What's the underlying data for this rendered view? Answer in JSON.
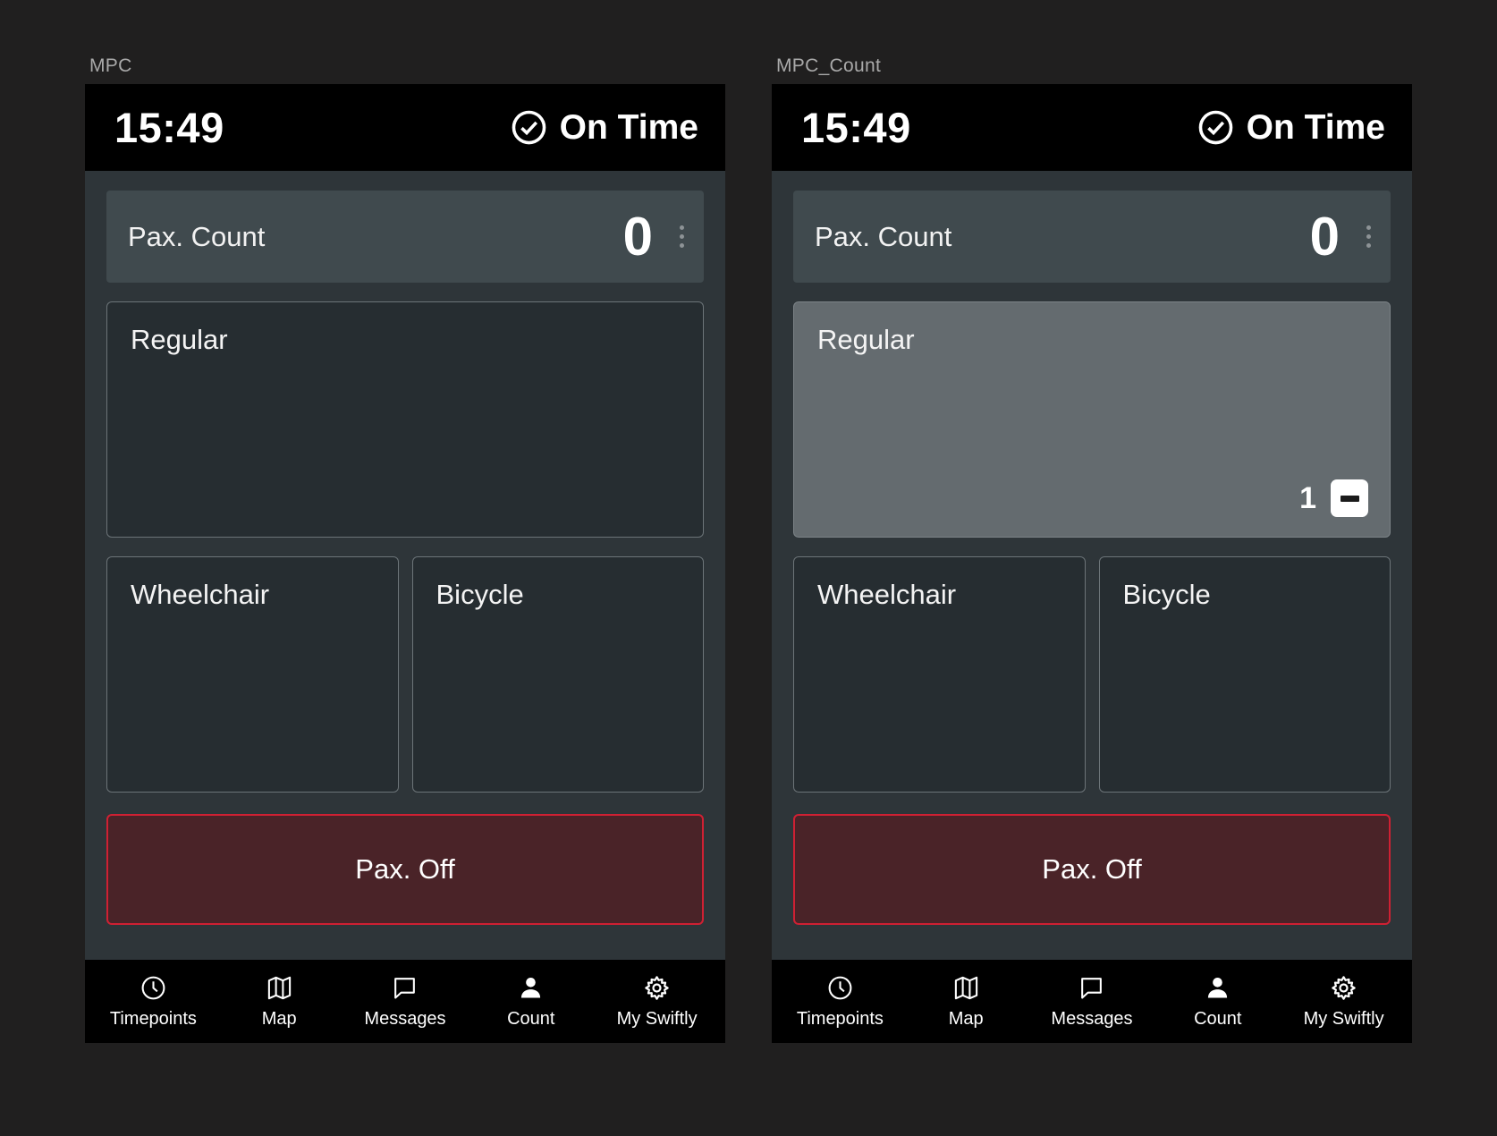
{
  "page": {
    "background_color": "#201f1f"
  },
  "panels": [
    {
      "caption": "MPC",
      "statusbar": {
        "time": "15:49",
        "status_label": "On Time",
        "status_icon": "check-circle-icon"
      },
      "pax_count": {
        "label": "Pax. Count",
        "value": "0",
        "menu_icon": "kebab-menu-icon"
      },
      "categories": [
        {
          "label": "Regular",
          "active": false,
          "counter": null
        },
        {
          "label": "Wheelchair",
          "active": false,
          "counter": null
        },
        {
          "label": "Bicycle",
          "active": false,
          "counter": null
        }
      ],
      "pax_off": {
        "label": "Pax. Off",
        "border_color": "#cf2033",
        "fill_color": "#4a2328"
      }
    },
    {
      "caption": "MPC_Count",
      "statusbar": {
        "time": "15:49",
        "status_label": "On Time",
        "status_icon": "check-circle-icon"
      },
      "pax_count": {
        "label": "Pax. Count",
        "value": "0",
        "menu_icon": "kebab-menu-icon"
      },
      "categories": [
        {
          "label": "Regular",
          "active": true,
          "counter": {
            "value": "1",
            "decrement_icon": "minus-icon"
          }
        },
        {
          "label": "Wheelchair",
          "active": false,
          "counter": null
        },
        {
          "label": "Bicycle",
          "active": false,
          "counter": null
        }
      ],
      "pax_off": {
        "label": "Pax. Off",
        "border_color": "#cf2033",
        "fill_color": "#4a2328"
      }
    }
  ],
  "navbar": {
    "items": [
      {
        "label": "Timepoints",
        "icon": "clock-icon",
        "selected": false
      },
      {
        "label": "Map",
        "icon": "map-icon",
        "selected": false
      },
      {
        "label": "Messages",
        "icon": "message-bubble-icon",
        "selected": false
      },
      {
        "label": "Count",
        "icon": "person-icon",
        "selected": true
      },
      {
        "label": "My Swiftly",
        "icon": "gear-icon",
        "selected": false
      }
    ]
  }
}
